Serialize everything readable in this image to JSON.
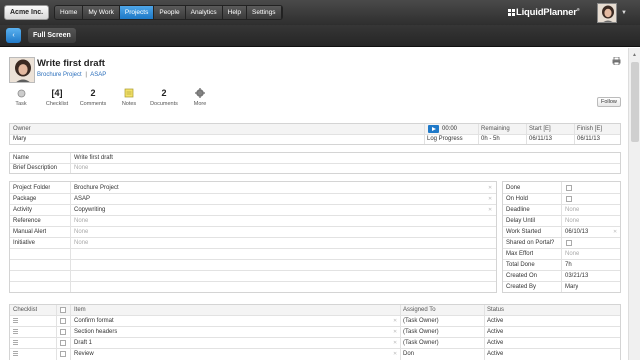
{
  "topbar": {
    "workspace": "Acme Inc.",
    "tabs": [
      "Home",
      "My Work",
      "Projects",
      "People",
      "Analytics",
      "Help",
      "Settings"
    ],
    "active_tab": "Projects",
    "logo_text": "LiquidPlanner",
    "logo_mark": "®"
  },
  "subbar": {
    "back_icon": "‹",
    "fullscreen_label": "Full Screen"
  },
  "task": {
    "title": "Write first draft",
    "project": "Brochure Project",
    "separator": "|",
    "package": "ASAP"
  },
  "stats": {
    "task_label": "Task",
    "checklist_value": "[4]",
    "checklist_label": "Checklist",
    "comments_value": "2",
    "comments_label": "Comments",
    "notes_label": "Notes",
    "documents_value": "2",
    "documents_label": "Documents",
    "more_label": "More"
  },
  "follow_label": "Follow",
  "owner_table": {
    "owner_header": "Owner",
    "owner_value": "Mary",
    "timer_value": "00:00",
    "log_progress": "Log Progress",
    "remaining_header": "Remaining",
    "remaining_value": "0h - 5h",
    "start_header": "Start [E]",
    "start_value": "06/11/13",
    "finish_header": "Finish [E]",
    "finish_value": "06/11/13"
  },
  "name_table": {
    "name_label": "Name",
    "name_value": "Write first draft",
    "desc_label": "Brief Description",
    "desc_value": "None"
  },
  "props_left": [
    {
      "label": "Project Folder",
      "value": "Brochure Project",
      "muted": false
    },
    {
      "label": "Package",
      "value": "ASAP",
      "muted": false
    },
    {
      "label": "Activity",
      "value": "Copywriting",
      "muted": false
    },
    {
      "label": "Reference",
      "value": "None",
      "muted": true
    },
    {
      "label": "Manual Alert",
      "value": "None",
      "muted": true
    },
    {
      "label": "Initiative",
      "value": "None",
      "muted": true
    }
  ],
  "props_right": [
    {
      "label": "Done",
      "value": "",
      "type": "check"
    },
    {
      "label": "On Hold",
      "value": "",
      "type": "check"
    },
    {
      "label": "Deadline",
      "value": "None",
      "type": "muted"
    },
    {
      "label": "Delay Until",
      "value": "None",
      "type": "muted"
    },
    {
      "label": "Work Started",
      "value": "06/10/13",
      "type": "text"
    },
    {
      "label": "Shared on Portal?",
      "value": "",
      "type": "check"
    },
    {
      "label": "Max Effort",
      "value": "None",
      "type": "muted"
    },
    {
      "label": "Total Done",
      "value": "7h",
      "type": "text"
    },
    {
      "label": "Created On",
      "value": "03/21/13",
      "type": "text"
    },
    {
      "label": "Created By",
      "value": "Mary",
      "type": "text"
    }
  ],
  "checklist": {
    "headers": {
      "checklist": "Checklist",
      "item": "Item",
      "assigned": "Assigned To",
      "status": "Status"
    },
    "rows": [
      {
        "item": "Confirm format",
        "assigned": "(Task Owner)",
        "status": "Active"
      },
      {
        "item": "Section headers",
        "assigned": "(Task Owner)",
        "status": "Active"
      },
      {
        "item": "Draft 1",
        "assigned": "(Task Owner)",
        "status": "Active"
      },
      {
        "item": "Review",
        "assigned": "Don",
        "status": "Active"
      }
    ]
  },
  "colors": {
    "accent": "#1f79c8",
    "link": "#2a6ebb",
    "topbar": "#3a3a3a"
  }
}
